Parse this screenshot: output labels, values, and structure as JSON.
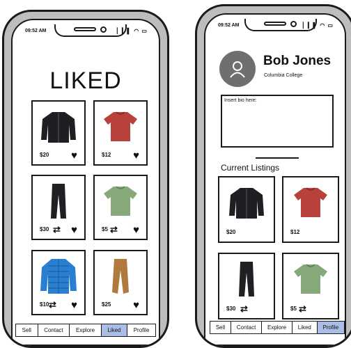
{
  "liked_screen": {
    "status_time": "09:52 AM",
    "status_icons": "▏▎▌ ◠ ▭",
    "title": "LIKED",
    "items": [
      {
        "price": "$20",
        "image_icon": "jacket-icon",
        "swap": "",
        "liked": true
      },
      {
        "price": "$12",
        "image_icon": "tshirt-red-icon",
        "swap": "",
        "liked": true
      },
      {
        "price": "$30",
        "image_icon": "pants-black-icon",
        "swap": "⇄",
        "liked": true
      },
      {
        "price": "$5",
        "image_icon": "tshirt-green-icon",
        "swap": "⇄",
        "liked": true
      },
      {
        "price": "$10",
        "image_icon": "puffer-jacket-icon",
        "swap": "⇄",
        "liked": true
      },
      {
        "price": "$25",
        "image_icon": "pants-khaki-icon",
        "swap": "",
        "liked": true
      }
    ],
    "tabs": [
      {
        "label": "Sell",
        "active": false
      },
      {
        "label": "Contact",
        "active": false
      },
      {
        "label": "Explore",
        "active": false
      },
      {
        "label": "Liked",
        "active": true
      },
      {
        "label": "Profile",
        "active": false
      }
    ]
  },
  "profile_screen": {
    "status_time": "09:52 AM",
    "status_icons": "▏▎▌ ◠ ▭",
    "name": "Bob Jones",
    "school": "Columbia College",
    "bio_placeholder": "Insert bio here:",
    "listings_title": "Current Listings",
    "listings": [
      {
        "price": "$20",
        "image_icon": "jacket-icon",
        "swap": ""
      },
      {
        "price": "$12",
        "image_icon": "tshirt-red-icon",
        "swap": ""
      },
      {
        "price": "$30",
        "image_icon": "pants-black-icon",
        "swap": "⇄"
      },
      {
        "price": "$5",
        "image_icon": "tshirt-green-icon",
        "swap": "⇄"
      }
    ],
    "tabs": [
      {
        "label": "Sell",
        "active": false
      },
      {
        "label": "Contact",
        "active": false
      },
      {
        "label": "Explore",
        "active": false
      },
      {
        "label": "Liked",
        "active": false
      },
      {
        "label": "Profile",
        "active": true
      }
    ]
  },
  "colors": {
    "active_tab": "#a9bde6",
    "avatar": "#6f6f6f",
    "phone_frame": "#bdbdbd",
    "red_shirt": "#b8413c",
    "green_shirt": "#87a878",
    "blue_jacket": "#2a7fd0",
    "khaki_pants": "#b07a3e"
  }
}
